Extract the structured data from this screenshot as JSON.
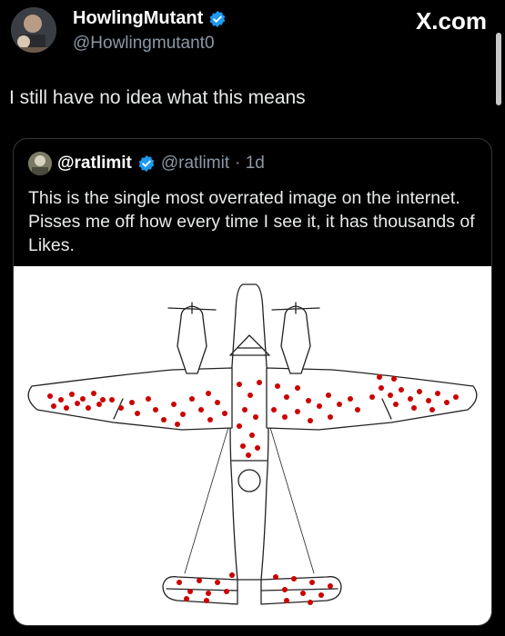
{
  "tweet": {
    "display_name": "HowlingMutant",
    "handle": "@Howlingmutant0",
    "text": "I still have no idea what this means",
    "brand": "X.com"
  },
  "quote": {
    "display_name": "@ratlimit",
    "handle": "@ratlimit",
    "time": "· 1d",
    "text": "This is the single most overrated image on the internet. Pisses me off how every time I see it, it has thousands of Likes."
  },
  "icons": {
    "verified": "verified-badge-icon",
    "brand": "x-logo-icon",
    "avatar": "avatar-photo",
    "quote_avatar": "avatar-photo",
    "image": "airplane-bullet-holes-diagram"
  },
  "colors": {
    "background": "#000000",
    "text_primary": "#e7e9ea",
    "text_secondary": "#8b98a5",
    "verified": "#1d9bf0",
    "bullet_holes": "#cc0000"
  }
}
